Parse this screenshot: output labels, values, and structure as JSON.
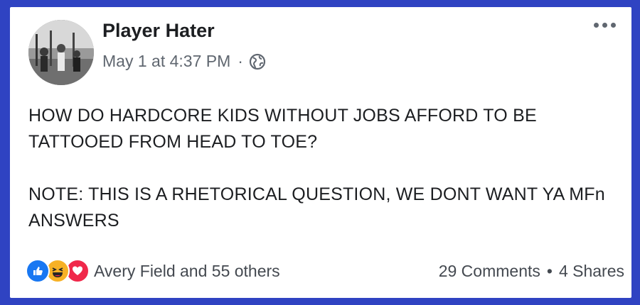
{
  "post": {
    "author": "Player Hater",
    "timestamp": "May 1 at 4:37 PM",
    "separator": "·",
    "privacy_icon": "globe-icon",
    "more_icon": "more-options-icon",
    "paragraphs": [
      "HOW DO HARDCORE KIDS WITHOUT JOBS AFFORD TO BE TATTOOED FROM HEAD TO TOE?",
      "NOTE: THIS IS A RHETORICAL QUESTION, WE DONT WANT YA MFn ANSWERS"
    ]
  },
  "footer": {
    "reaction_icons": [
      "like-icon",
      "haha-icon",
      "love-icon"
    ],
    "reactions_text": "Avery Field and 55 others",
    "comments": "29 Comments",
    "separator": "•",
    "shares": "4 Shares"
  },
  "colors": {
    "frame": "#2f43c2",
    "like": "#1877f2",
    "haha": "#f7b125",
    "love": "#f0284a",
    "meta_text": "#606770"
  }
}
